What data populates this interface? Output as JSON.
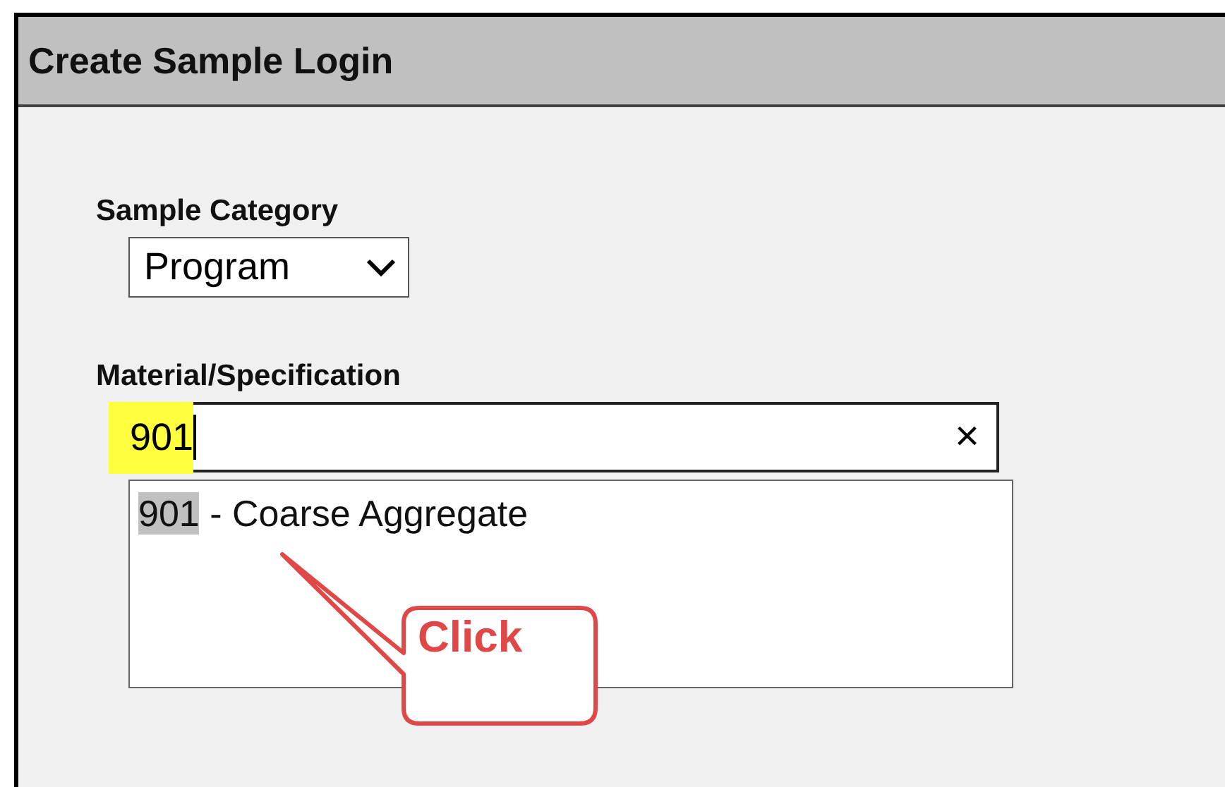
{
  "window": {
    "title": "Create Sample Login"
  },
  "sample_category": {
    "label": "Sample Category",
    "value": "Program"
  },
  "material_specification": {
    "label": "Material/Specification",
    "value": "901",
    "clear": "×",
    "suggestions": [
      {
        "match": "901",
        "rest": " - Coarse Aggregate"
      }
    ]
  },
  "callout": {
    "text": "Click"
  }
}
